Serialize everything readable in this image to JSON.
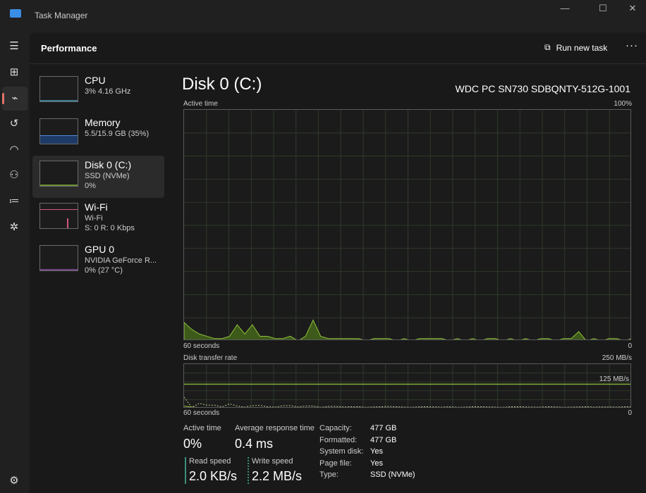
{
  "window": {
    "title": "Task Manager",
    "minimize": "—",
    "maximize": "☐",
    "close": "✕"
  },
  "header": {
    "title": "Performance",
    "run_new_task": "Run new task",
    "more": "···"
  },
  "sidebar": [
    {
      "name": "CPU",
      "line1": "3% 4.16 GHz",
      "line2": "",
      "color": "#4ea7c9"
    },
    {
      "name": "Memory",
      "line1": "5.5/15.9 GB (35%)",
      "line2": "",
      "color": "#4d8ad6"
    },
    {
      "name": "Disk 0 (C:)",
      "line1": "SSD (NVMe)",
      "line2": "0%",
      "color": "#8fbf3a"
    },
    {
      "name": "Wi-Fi",
      "line1": "Wi-Fi",
      "line2": "S: 0 R: 0 Kbps",
      "color": "#d0577e"
    },
    {
      "name": "GPU 0",
      "line1": "NVIDIA GeForce R...",
      "line2": "0% (27 °C)",
      "color": "#9b59b6"
    }
  ],
  "detail": {
    "title": "Disk 0 (C:)",
    "model": "WDC PC SN730 SDBQNTY-512G-1001",
    "active_label": "Active time",
    "active_max": "100%",
    "time_span": "60 seconds",
    "zero": "0",
    "transfer_label": "Disk transfer rate",
    "transfer_max": "250 MB/s",
    "transfer_mid": "125 MB/s"
  },
  "stats": {
    "active_time_label": "Active time",
    "active_time": "0%",
    "avg_resp_label": "Average response time",
    "avg_resp": "0.4 ms",
    "read_label": "Read speed",
    "read": "2.0 KB/s",
    "write_label": "Write speed",
    "write": "2.2 MB/s"
  },
  "props": [
    [
      "Capacity:",
      "477 GB"
    ],
    [
      "Formatted:",
      "477 GB"
    ],
    [
      "System disk:",
      "Yes"
    ],
    [
      "Page file:",
      "Yes"
    ],
    [
      "Type:",
      "SSD (NVMe)"
    ]
  ],
  "chart_data": {
    "type": "area",
    "title": "Active time",
    "ylim": [
      0,
      100
    ],
    "active": [
      8,
      5,
      3,
      2,
      1,
      1,
      2,
      7,
      3,
      7,
      2,
      2,
      1,
      1,
      2,
      0,
      2,
      9,
      2,
      1,
      1,
      1,
      1,
      1,
      0,
      1,
      1,
      1,
      0,
      1,
      0,
      1,
      1,
      1,
      1,
      0,
      1,
      0,
      1,
      0,
      1,
      1,
      0,
      1,
      0,
      1,
      0,
      1,
      1,
      0,
      1,
      1,
      4,
      0,
      1,
      0,
      1,
      1,
      0,
      1
    ],
    "transfer_ylim": [
      0,
      250
    ],
    "read": [
      10,
      4,
      2,
      1,
      1,
      1,
      1,
      1,
      1,
      0,
      1,
      1,
      1,
      0,
      1,
      1,
      1,
      1,
      0,
      1,
      1,
      1,
      1,
      0,
      1,
      1,
      1,
      1,
      0,
      1,
      1,
      1,
      1,
      0,
      1,
      1,
      1,
      0,
      1,
      1,
      1,
      1,
      0,
      1,
      1,
      1,
      1,
      0,
      1,
      1,
      1,
      1,
      0,
      1,
      1,
      1,
      1,
      0,
      1,
      1
    ],
    "write": [
      60,
      2,
      25,
      15,
      15,
      5,
      22,
      10,
      4,
      12,
      14,
      6,
      4,
      12,
      12,
      5,
      10,
      10,
      3,
      8,
      8,
      5,
      6,
      6,
      3,
      5,
      6,
      8,
      6,
      4,
      3,
      6,
      6,
      5,
      4,
      6,
      3,
      4,
      6,
      6,
      5,
      4,
      3,
      6,
      6,
      5,
      4,
      4,
      6,
      5,
      3,
      4,
      5,
      6,
      4,
      5,
      5,
      4,
      6,
      6
    ]
  }
}
